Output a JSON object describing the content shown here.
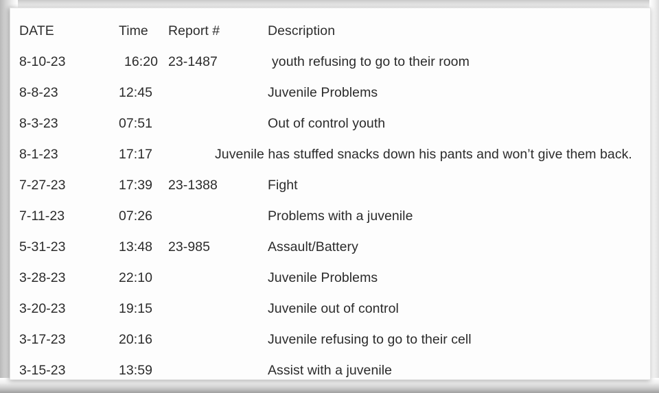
{
  "document": {
    "type": "scanned-table",
    "background_color": "#ffffff",
    "sheet_color": "#fdfdfd",
    "text_color": "#2b2b2b"
  },
  "table": {
    "columns": [
      {
        "key": "date",
        "label": "DATE"
      },
      {
        "key": "time",
        "label": "Time"
      },
      {
        "key": "report",
        "label": "Report #"
      },
      {
        "key": "description",
        "label": "Description"
      }
    ],
    "rows": [
      {
        "date": "8-10-23",
        "time": "16:20",
        "report": "23-1487",
        "description": "youth refusing to go to their room"
      },
      {
        "date": "8-8-23",
        "time": "12:45",
        "report": "",
        "description": "Juvenile Problems"
      },
      {
        "date": "8-3-23",
        "time": "07:51",
        "report": "",
        "description": "Out of control youth"
      },
      {
        "date": "8-1-23",
        "time": "17:17",
        "report": "",
        "description": "Juvenile has stuffed snacks down his pants and won’t give them back."
      },
      {
        "date": "7-27-23",
        "time": "17:39",
        "report": "23-1388",
        "description": "Fight"
      },
      {
        "date": "7-11-23",
        "time": "07:26",
        "report": "",
        "description": "Problems with a juvenile"
      },
      {
        "date": "5-31-23",
        "time": "13:48",
        "report": "23-985",
        "description": "Assault/Battery"
      },
      {
        "date": "3-28-23",
        "time": "22:10",
        "report": "",
        "description": "Juvenile Problems"
      },
      {
        "date": "3-20-23",
        "time": "19:15",
        "report": "",
        "description": "Juvenile out of control"
      },
      {
        "date": "3-17-23",
        "time": "20:16",
        "report": "",
        "description": "Juvenile refusing to go to their cell"
      },
      {
        "date": "3-15-23",
        "time": "13:59",
        "report": "",
        "description": "Assist with a juvenile"
      }
    ]
  }
}
